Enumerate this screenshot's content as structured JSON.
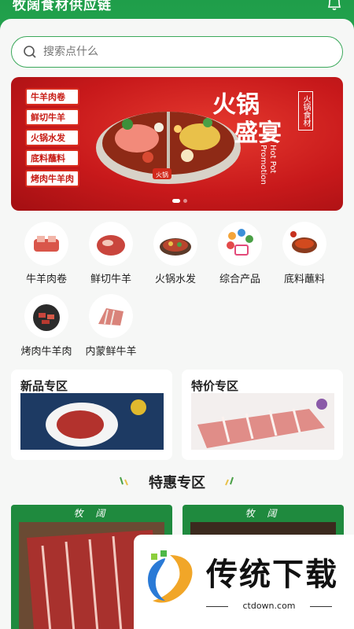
{
  "header": {
    "title": "牧阔食材供应链",
    "bell_icon": "bell-icon"
  },
  "search": {
    "placeholder": "搜索点什么"
  },
  "banner": {
    "tags": [
      "牛羊肉卷",
      "鲜切牛羊",
      "火锅水发",
      "底料蘸料",
      "烤肉牛羊肉"
    ],
    "title_line1": "火锅",
    "title_line2": "盛宴",
    "english": "Hot Pot Promotion",
    "brand": "火锅食材",
    "pot_badge": "火锅"
  },
  "categories": [
    {
      "label": "牛羊肉卷",
      "icon": "meat-roll-icon"
    },
    {
      "label": "鲜切牛羊",
      "icon": "fresh-cut-icon"
    },
    {
      "label": "火锅水发",
      "icon": "hotpot-icon"
    },
    {
      "label": "综合产品",
      "icon": "products-icon"
    },
    {
      "label": "底料蘸料",
      "icon": "sauce-icon"
    },
    {
      "label": "烤肉牛羊肉",
      "icon": "bbq-icon"
    },
    {
      "label": "内蒙鲜牛羊",
      "icon": "lamb-rack-icon"
    }
  ],
  "zones": {
    "new_label": "新品专区",
    "sale_label": "特价专区"
  },
  "section": {
    "title": "特惠专区"
  },
  "products": [
    {
      "label": "牧 阔"
    },
    {
      "label": "牧 阔"
    }
  ],
  "watermark": {
    "text": "传统下载",
    "url": "ctdown.com"
  },
  "colors": {
    "brand_green": "#27a650",
    "banner_red": "#c8191b"
  }
}
